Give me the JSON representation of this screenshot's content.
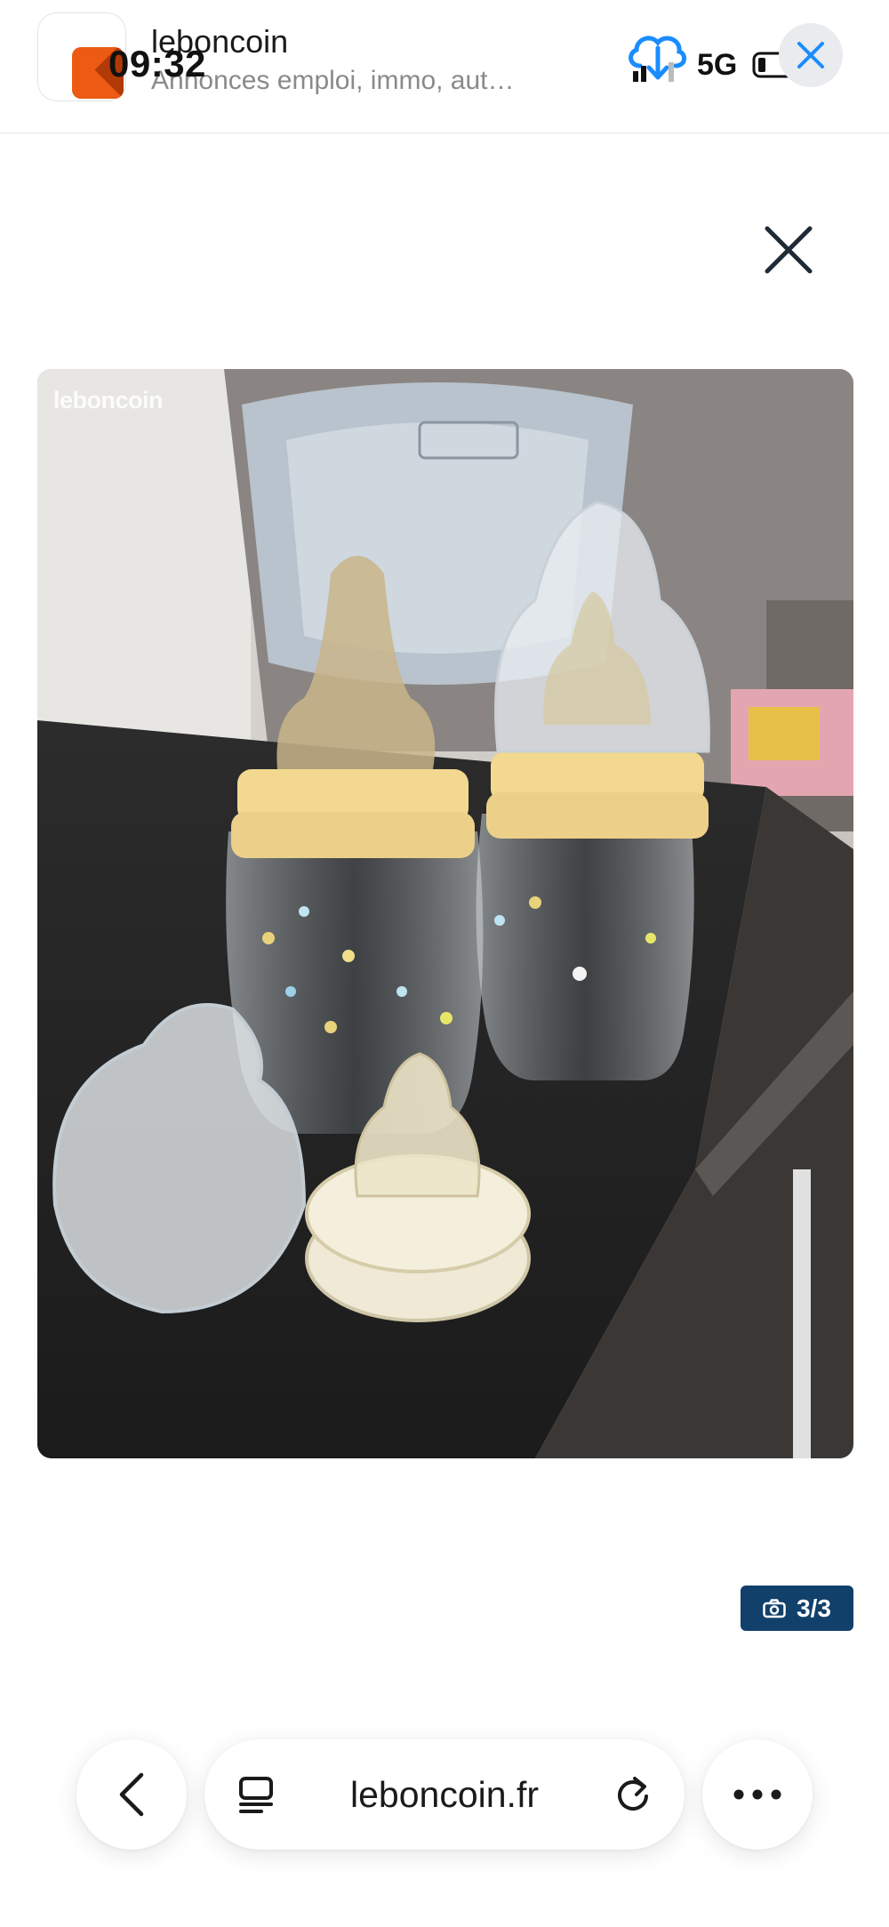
{
  "status_bar": {
    "time": "09:32",
    "network": "5G"
  },
  "app_banner": {
    "app_name": "leboncoin",
    "subtitle": "Annonces emploi, immo, aut…"
  },
  "photo": {
    "watermark": "leboncoin"
  },
  "image_counter": {
    "current": "3",
    "total": "/3"
  },
  "browser": {
    "url": "leboncoin.fr"
  },
  "colors": {
    "brand_orange": "#ec5a13",
    "counter_bg": "#11406b",
    "cloud_blue": "#1a8cff"
  }
}
